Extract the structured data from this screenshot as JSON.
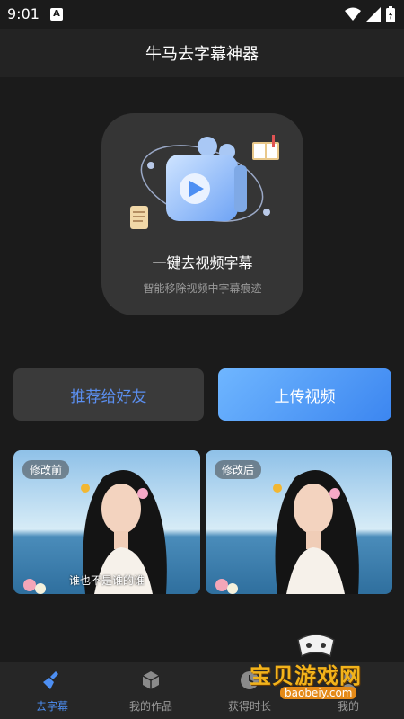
{
  "status_bar": {
    "time": "9:01",
    "notification_letter": "A"
  },
  "header": {
    "title": "牛马去字幕神器"
  },
  "feature": {
    "title": "一键去视频字幕",
    "subtitle": "智能移除视频中字幕痕迹",
    "icon": "play-cube-icon"
  },
  "actions": {
    "recommend_label": "推荐给好友",
    "upload_label": "上传视频"
  },
  "compare": {
    "before_tag": "修改前",
    "after_tag": "修改后",
    "subtitle_text": "谁也不是谁的谁"
  },
  "nav": {
    "items": [
      {
        "label": "去字幕",
        "icon": "broom-icon",
        "active": true
      },
      {
        "label": "我的作品",
        "icon": "cube-icon",
        "active": false
      },
      {
        "label": "获得时长",
        "icon": "clock-icon",
        "active": false
      },
      {
        "label": "我的",
        "icon": "user-icon",
        "active": false
      }
    ]
  },
  "watermark": {
    "text": "宝贝游戏网",
    "url": "baobeiy.com"
  },
  "colors": {
    "accent": "#4d8ff3",
    "background": "#1b1b1b",
    "card": "#353535",
    "watermark": "#f2b31b"
  }
}
